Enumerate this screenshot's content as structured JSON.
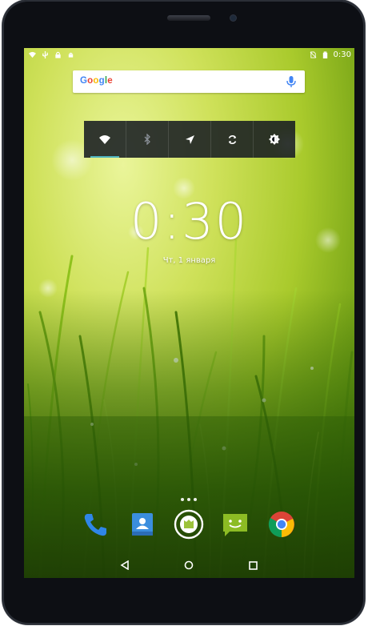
{
  "status_bar": {
    "left_icons": [
      "wifi-signal-icon",
      "usb-icon",
      "lock-icon",
      "android-debug-icon"
    ],
    "right_icons": [
      "no-sim-icon",
      "battery-icon"
    ],
    "time": "0:30"
  },
  "search_widget": {
    "logo_letters": [
      "G",
      "o",
      "o",
      "g",
      "l",
      "e"
    ],
    "icons": [
      "mic-icon"
    ]
  },
  "quick_settings": {
    "buttons": [
      {
        "icon": "wifi-icon",
        "state": "on"
      },
      {
        "icon": "bluetooth-icon",
        "state": "off"
      },
      {
        "icon": "location-icon",
        "state": "off"
      },
      {
        "icon": "sync-icon",
        "state": "off"
      },
      {
        "icon": "brightness-icon",
        "state": "off"
      }
    ]
  },
  "lock_clock": {
    "time": "0:30",
    "date": "Чт, 1 января"
  },
  "dock": {
    "apps": [
      "phone-icon",
      "contacts-icon",
      "app-drawer-icon",
      "messaging-icon",
      "chrome-icon"
    ]
  },
  "nav_bar": {
    "buttons": [
      "back-icon",
      "home-icon",
      "recents-icon"
    ]
  },
  "colors": {
    "bezel": "#0d0f14",
    "wallpaper_light": "#d5e86a",
    "wallpaper_dark": "#2a5a06",
    "qs_panel": "#181c22",
    "qs_active": "#4fb3bf"
  }
}
